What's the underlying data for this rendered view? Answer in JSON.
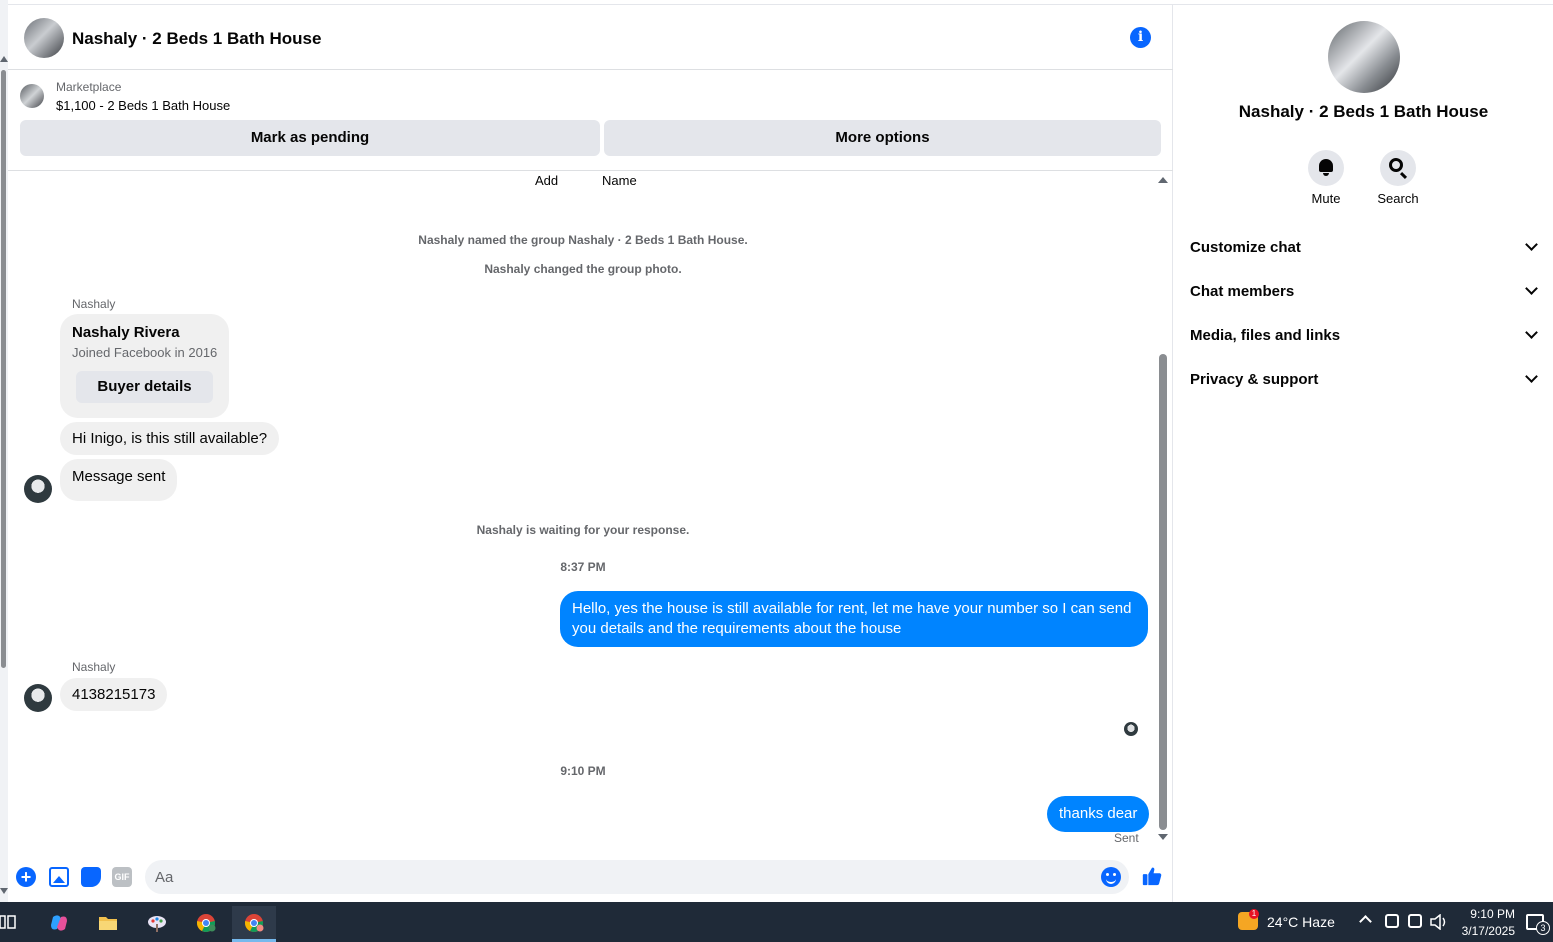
{
  "conversation": {
    "title": "Nashaly · 2 Beds 1 Bath House",
    "info_icon": "info-icon"
  },
  "marketplace": {
    "label": "Marketplace",
    "listing": "$1,100 - 2 Beds 1 Bath House",
    "mark_pending_label": "Mark as pending",
    "more_options_label": "More options"
  },
  "messages": {
    "add_label": "Add",
    "name_label": "Name",
    "sys_named": "Nashaly named the group Nashaly · 2 Beds 1 Bath House.",
    "sys_photo": "Nashaly changed the group photo.",
    "sender_1": "Nashaly",
    "buyer_card": {
      "name": "Nashaly Rivera",
      "joined": "Joined Facebook in 2016",
      "button": "Buyer details"
    },
    "in_1": "Hi Inigo, is this still available?",
    "in_2": "Message sent",
    "sys_waiting": "Nashaly is waiting for your response.",
    "time_1": "8:37 PM",
    "out_1": "Hello, yes the house is still available for rent, let me have your number so I can send you details and the requirements about the house",
    "sender_2": "Nashaly",
    "in_3": "4138215173",
    "time_2": "9:10 PM",
    "out_2": "thanks dear",
    "status": "Sent"
  },
  "composer": {
    "placeholder": "Aa"
  },
  "panel": {
    "title": "Nashaly · 2 Beds 1 Bath House",
    "mute_label": "Mute",
    "search_label": "Search",
    "sections": [
      "Customize chat",
      "Chat members",
      "Media, files and links",
      "Privacy & support"
    ]
  },
  "taskbar": {
    "widget_badge": "1",
    "weather": "24°C  Haze",
    "time": "9:10 PM",
    "date": "3/17/2025",
    "notification_count": "3"
  },
  "colors": {
    "accent": "#0866ff",
    "outgoing_bubble": "#0084ff",
    "incoming_bubble": "#f0f0f0",
    "taskbar": "#1f2a38"
  }
}
